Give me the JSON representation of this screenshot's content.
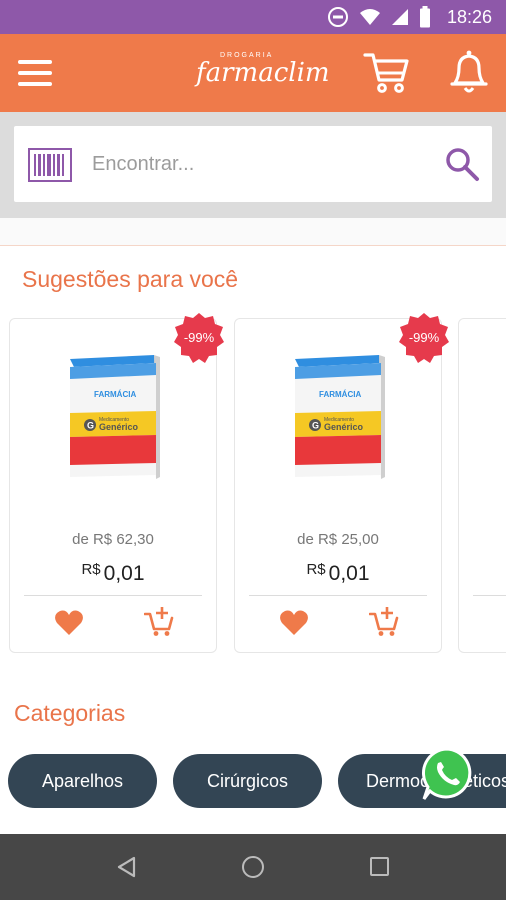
{
  "status_bar": {
    "time": "18:26"
  },
  "header": {
    "logo_small": "DROGARIA",
    "logo_main": "farmaclim"
  },
  "search": {
    "placeholder": "Encontrar..."
  },
  "suggestions": {
    "title": "Sugestões para você",
    "products": [
      {
        "box_label": "FARMÁCIA",
        "box_sub": "Medicamento",
        "box_main": "Genérico",
        "discount": "-99%",
        "old_price": "de R$ 62,30",
        "currency": "R$",
        "price": "0,01"
      },
      {
        "box_label": "FARMÁCIA",
        "box_sub": "Medicamento",
        "box_main": "Genérico",
        "discount": "-99%",
        "old_price": "de R$ 25,00",
        "currency": "R$",
        "price": "0,01"
      }
    ]
  },
  "categories": {
    "title": "Categorias",
    "items": [
      "Aparelhos",
      "Cirúrgicos",
      "Dermocosméticos"
    ]
  },
  "colors": {
    "status_bar": "#8e58a9",
    "header": "#ef7a4a",
    "accent": "#e9744a",
    "chip": "#334554",
    "search_icon": "#8e58a9",
    "whatsapp": "#3fc350"
  },
  "icons": [
    "menu-icon",
    "cart-icon",
    "bell-icon",
    "barcode-icon",
    "search-icon",
    "heart-icon",
    "add-cart-icon",
    "whatsapp-icon",
    "back-icon",
    "home-icon",
    "recents-icon"
  ]
}
